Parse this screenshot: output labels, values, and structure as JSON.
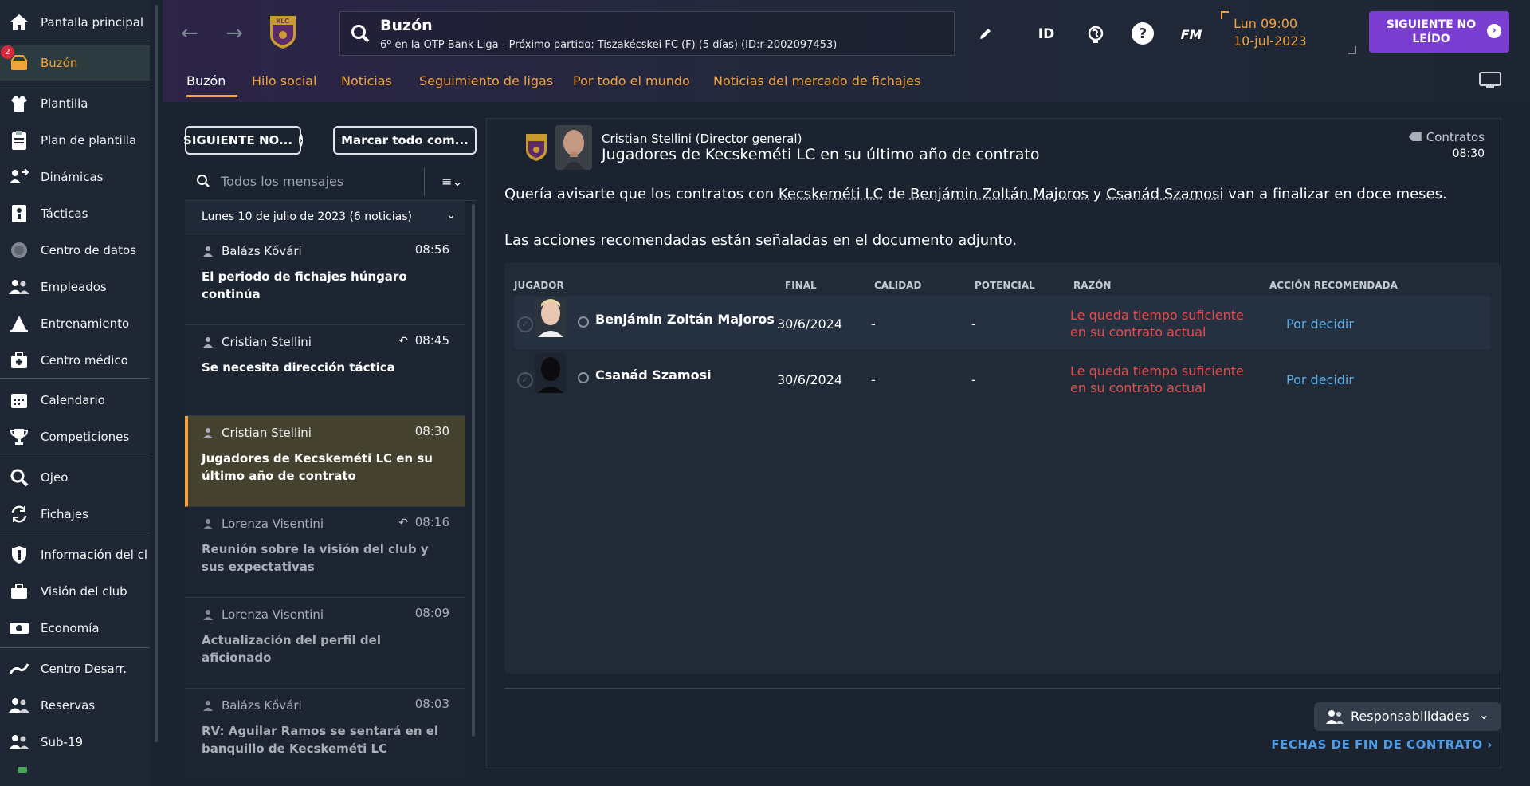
{
  "sidebar": {
    "items": [
      {
        "label": "Pantalla principal",
        "icon": "home-icon"
      },
      {
        "label": "Buzón",
        "icon": "inbox-icon",
        "badge": "2"
      },
      {
        "label": "Plantilla",
        "icon": "shirt-icon"
      },
      {
        "label": "Plan de plantilla",
        "icon": "clipboard-icon"
      },
      {
        "label": "Dinámicas",
        "icon": "dynamics-icon"
      },
      {
        "label": "Tácticas",
        "icon": "tactics-icon"
      },
      {
        "label": "Centro de datos",
        "icon": "data-icon"
      },
      {
        "label": "Empleados",
        "icon": "staff-icon"
      },
      {
        "label": "Entrenamiento",
        "icon": "training-icon"
      },
      {
        "label": "Centro médico",
        "icon": "medical-icon"
      },
      {
        "label": "Calendario",
        "icon": "calendar-icon"
      },
      {
        "label": "Competiciones",
        "icon": "trophy-icon"
      },
      {
        "label": "Ojeo",
        "icon": "scouting-icon"
      },
      {
        "label": "Fichajes",
        "icon": "transfers-icon"
      },
      {
        "label": "Información del cl...",
        "icon": "club-info-icon"
      },
      {
        "label": "Visión del club",
        "icon": "briefcase-icon"
      },
      {
        "label": "Economía",
        "icon": "finance-icon"
      },
      {
        "label": "Centro Desarr.",
        "icon": "development-icon"
      },
      {
        "label": "Reservas",
        "icon": "reserves-icon"
      },
      {
        "label": "Sub-19",
        "icon": "u19-icon"
      }
    ]
  },
  "header": {
    "title": "Buzón",
    "subtitle": "6º en la OTP Bank Liga - Próximo partido: Tiszakécskei FC (F) (5 días) (ID:r-2002097453)",
    "crest_text": "KLC",
    "date_line1": "Lun 09:00",
    "date_line2": "10-jul-2023",
    "next_button": "SIGUIENTE NO LEÍDO",
    "id_label": "ID",
    "fm_label": "FM",
    "help_label": "?"
  },
  "tabs": [
    {
      "label": "Buzón",
      "active": true
    },
    {
      "label": "Hilo social"
    },
    {
      "label": "Noticias"
    },
    {
      "label": "Seguimiento de ligas"
    },
    {
      "label": "Por todo el mundo"
    },
    {
      "label": "Noticias del mercado de fichajes"
    }
  ],
  "list": {
    "next_btn": "SIGUIENTE NO...",
    "mark_btn": "Marcar todo com...",
    "search_placeholder": "Todos los mensajes",
    "group_title": "Lunes 10 de julio de 2023 (6 noticias)",
    "messages": [
      {
        "from": "Balázs Kővári",
        "time": "08:56",
        "subject": "El periodo de fichajes húngaro continúa",
        "read": false,
        "reply": false
      },
      {
        "from": "Cristian Stellini",
        "time": "08:45",
        "subject": "Se necesita dirección táctica",
        "read": false,
        "reply": true
      },
      {
        "from": "Cristian Stellini",
        "time": "08:30",
        "subject": "Jugadores de Kecskeméti LC en su último año de contrato",
        "read": false,
        "selected": true
      },
      {
        "from": "Lorenza Visentini",
        "time": "08:16",
        "subject": "Reunión sobre la visión del club y sus expectativas",
        "read": true,
        "reply": true
      },
      {
        "from": "Lorenza Visentini",
        "time": "08:09",
        "subject": "Actualización del perfil del aficionado",
        "read": true
      },
      {
        "from": "Balázs Kővári",
        "time": "08:03",
        "subject": "RV: Aguilar Ramos se sentará en el banquillo de Kecskeméti LC",
        "read": true
      }
    ]
  },
  "detail": {
    "sender": "Cristian Stellini  (Director general)",
    "title": "Jugadores de Kecskeméti LC en su último año de contrato",
    "category": "Contratos",
    "time": "08:30",
    "body_pre": "Quería avisarte que los contratos con ",
    "body_club": "Kecskeméti LC",
    "body_mid1": " de ",
    "body_p1": "Benjámin Zoltán Majoros",
    "body_mid2": " y ",
    "body_p2": "Csanád Szamosi",
    "body_post": " van a finalizar en doce meses.",
    "body2": "Las acciones recomendadas están señaladas en el documento adjunto.",
    "table": {
      "headers": [
        "JUGADOR",
        "FINAL",
        "CALIDAD",
        "POTENCIAL",
        "RAZÓN",
        "ACCIÓN RECOMENDADA"
      ],
      "rows": [
        {
          "name": "Benjámin Zoltán Majoros",
          "final": "30/6/2024",
          "calidad": "-",
          "potencial": "-",
          "razon": "Le queda tiempo suficiente en su contrato actual",
          "accion": "Por decidir"
        },
        {
          "name": "Csanád Szamosi",
          "final": "30/6/2024",
          "calidad": "-",
          "potencial": "-",
          "razon": "Le queda tiempo suficiente en su contrato actual",
          "accion": "Por decidir"
        }
      ]
    },
    "resp_btn": "Responsabilidades",
    "fechas_link": "FECHAS DE FIN DE CONTRATO"
  },
  "colors": {
    "accent": "#f2a23a",
    "purple": "#7a3ed1",
    "link": "#4e9be6",
    "reason": "#e84a4a"
  }
}
